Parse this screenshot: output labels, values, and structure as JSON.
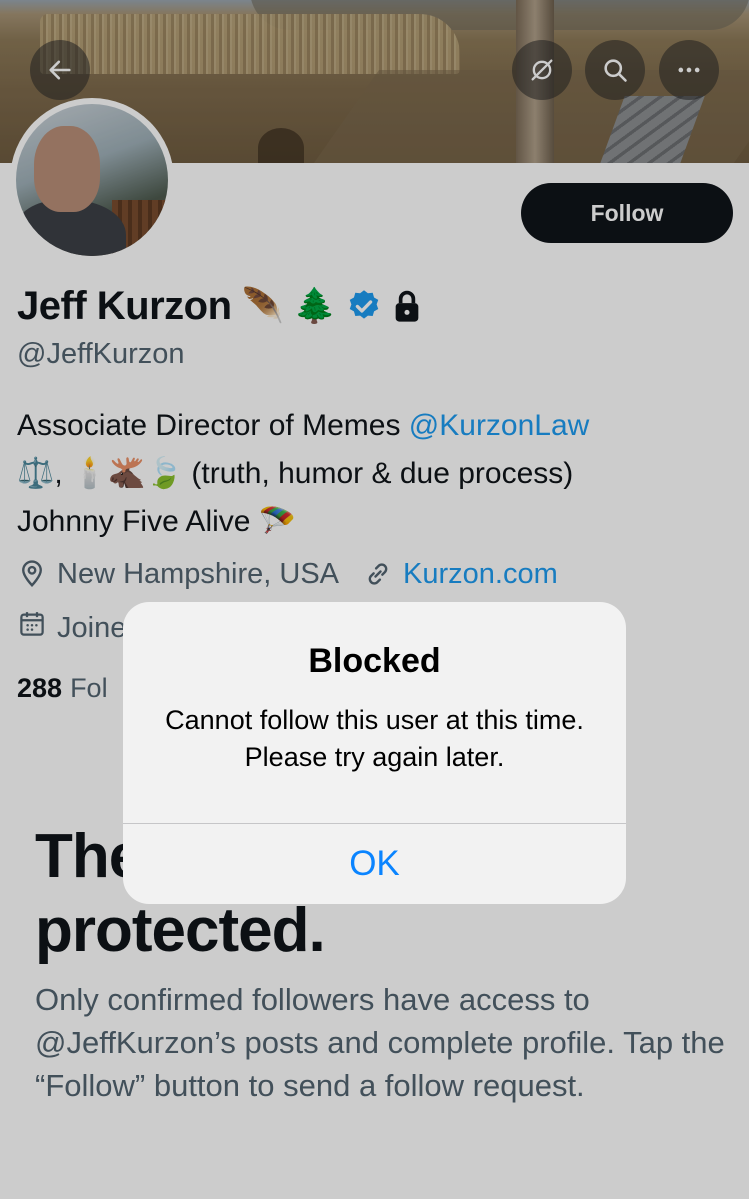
{
  "header": {
    "back_icon": "arrow-left-icon",
    "translate_icon": "no-translate-icon",
    "search_icon": "search-icon",
    "more_icon": "more-horizontal-icon"
  },
  "profile": {
    "follow_label": "Follow",
    "name": "Jeff Kurzon",
    "name_emojis": [
      "🪶",
      "🌲"
    ],
    "verified_icon": "verified-badge-icon",
    "lock_icon": "lock-icon",
    "handle": "@JeffKurzon",
    "bio_line1_text": "Associate Director of Memes ",
    "bio_line1_mention": "@KurzonLaw",
    "bio_line2": "⚖️, 🕯️🫎🍃 (truth, humor & due process)",
    "bio_line3": "Johnny Five Alive 🪂",
    "location": "New Hampshire, USA",
    "website": "Kurzon.com",
    "joined_partial": "Joine",
    "following_count": "288",
    "following_partial": "Fol"
  },
  "protected": {
    "title_partial": "The",
    "title_line2": "protected.",
    "body": "Only confirmed followers have access to @JeffKurzon’s posts and complete profile. Tap the “Follow” button to send a follow request."
  },
  "alert": {
    "title": "Blocked",
    "message": "Cannot follow this user at this time. Please try again later.",
    "ok_label": "OK"
  },
  "colors": {
    "link": "#1d9bf0",
    "ios_blue": "#0a84ff",
    "verified": "#1d9bf0",
    "text_primary": "#0f1419",
    "text_secondary": "#536471"
  }
}
